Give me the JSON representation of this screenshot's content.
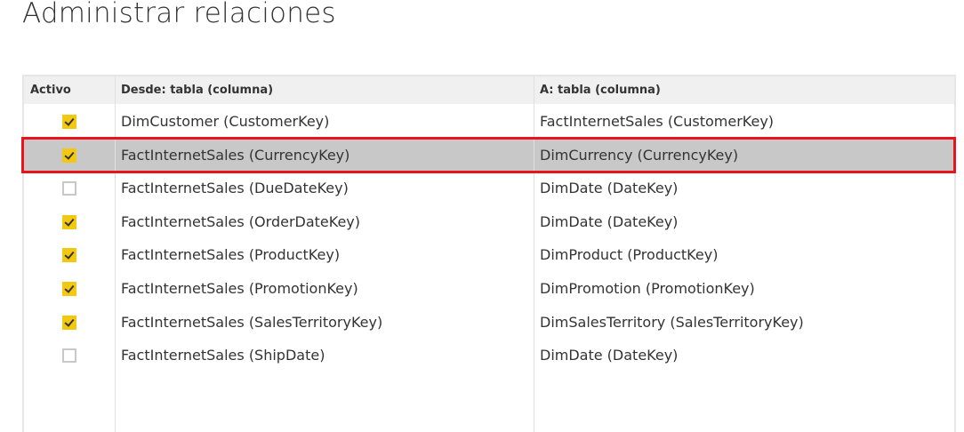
{
  "title": "Administrar relaciones",
  "columns": [
    "Activo",
    "Desde: tabla (columna)",
    "A: tabla (columna)"
  ],
  "rows": [
    {
      "active": true,
      "from": "DimCustomer (CustomerKey)",
      "to": "FactInternetSales (CustomerKey)",
      "selected": false
    },
    {
      "active": true,
      "from": "FactInternetSales (CurrencyKey)",
      "to": "DimCurrency (CurrencyKey)",
      "selected": true
    },
    {
      "active": false,
      "from": "FactInternetSales (DueDateKey)",
      "to": "DimDate (DateKey)",
      "selected": false
    },
    {
      "active": true,
      "from": "FactInternetSales (OrderDateKey)",
      "to": "DimDate (DateKey)",
      "selected": false
    },
    {
      "active": true,
      "from": "FactInternetSales (ProductKey)",
      "to": "DimProduct (ProductKey)",
      "selected": false
    },
    {
      "active": true,
      "from": "FactInternetSales (PromotionKey)",
      "to": "DimPromotion (PromotionKey)",
      "selected": false
    },
    {
      "active": true,
      "from": "FactInternetSales (SalesTerritoryKey)",
      "to": "DimSalesTerritory (SalesTerritoryKey)",
      "selected": false
    },
    {
      "active": false,
      "from": "FactInternetSales (ShipDate)",
      "to": "DimDate (DateKey)",
      "selected": false
    }
  ],
  "colors": {
    "checkbox_on": "#f2c811",
    "selection_border": "#e8141b",
    "selected_row": "#c8c8c8"
  }
}
